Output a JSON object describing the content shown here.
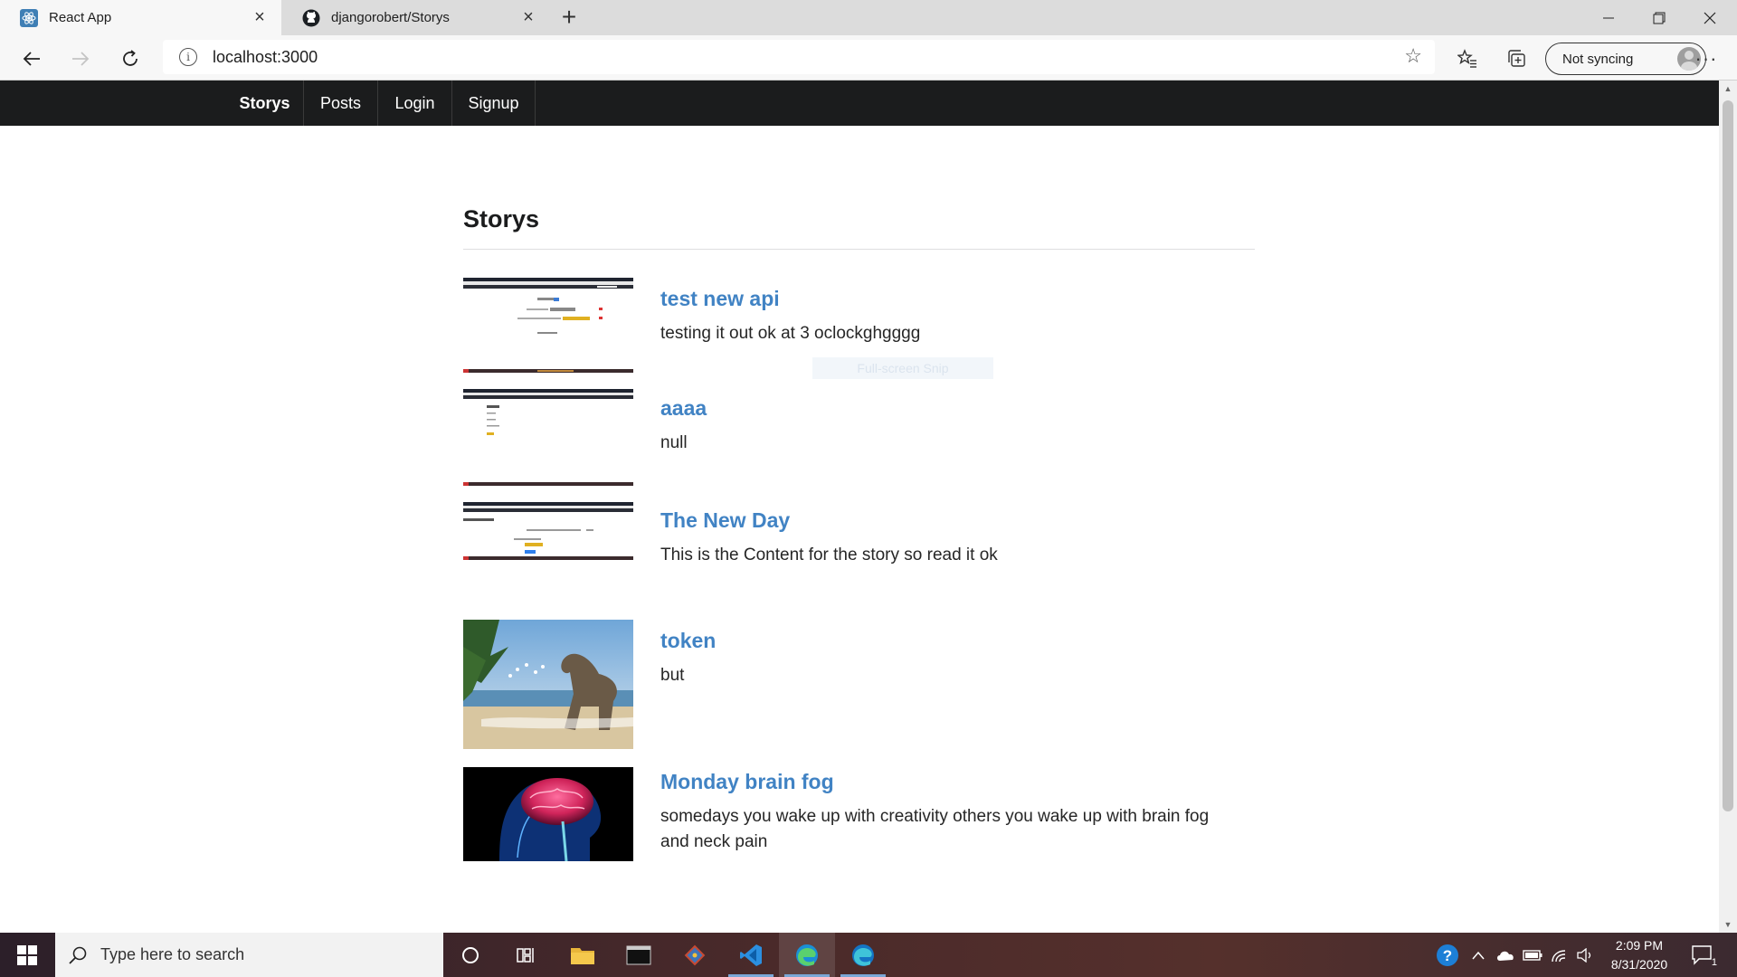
{
  "browser": {
    "tabs": [
      {
        "title": "React App",
        "icon": "react-icon",
        "active": true
      },
      {
        "title": "djangorobert/Storys",
        "icon": "github-icon",
        "active": false
      }
    ],
    "url": "localhost:3000",
    "sync_label": "Not syncing"
  },
  "app": {
    "nav": {
      "brand": "Storys",
      "links": [
        "Posts",
        "Login",
        "Signup"
      ]
    },
    "heading": "Storys",
    "snip_hint": "Full-screen Snip",
    "stories": [
      {
        "title": "test new api",
        "content": "testing it out ok at 3 oclockghgggg",
        "image": "screenshot-thumbnail"
      },
      {
        "title": "aaaa",
        "content": "null",
        "image": "login-screenshot-thumbnail"
      },
      {
        "title": "The New Day",
        "content": "This is the Content for the story so read it ok",
        "image": "order-summary-screenshot-thumbnail"
      },
      {
        "title": "token",
        "content": "but",
        "image": "dinosaur-beach-image"
      },
      {
        "title": "Monday brain fog",
        "content": "somedays you wake up with creativity others you wake up with brain fog and neck pain",
        "image": "brain-xray-image"
      }
    ]
  },
  "taskbar": {
    "search_placeholder": "Type here to search",
    "time": "2:09 PM",
    "date": "8/31/2020",
    "notification_count": "1"
  },
  "colors": {
    "nav_bg": "#1b1c1d",
    "link": "#4183c4",
    "text": "#262626"
  }
}
